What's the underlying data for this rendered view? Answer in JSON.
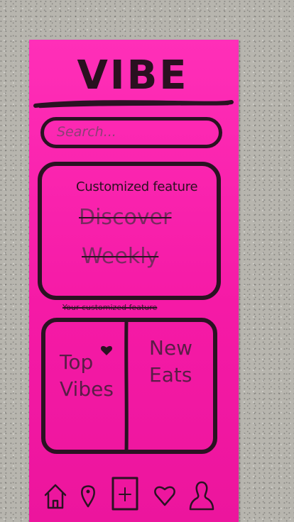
{
  "app": {
    "logo": "VIBE"
  },
  "search": {
    "placeholder": "Search..."
  },
  "feature": {
    "title": "Customized feature",
    "struck_line_1": "Discover",
    "struck_line_2": "Weekly"
  },
  "caption": {
    "text": "Your customized feature"
  },
  "tiles": [
    {
      "label": "Top\nVibes"
    },
    {
      "label": "New\nEats"
    }
  ],
  "tabs": [
    {
      "icon": "home-icon"
    },
    {
      "icon": "location-pin-icon"
    },
    {
      "icon": "add-icon"
    },
    {
      "icon": "heart-icon"
    },
    {
      "icon": "profile-icon"
    }
  ],
  "colors": {
    "paper": "#f51aa6",
    "ink": "#2a1222",
    "background": "#b7b5ae"
  }
}
